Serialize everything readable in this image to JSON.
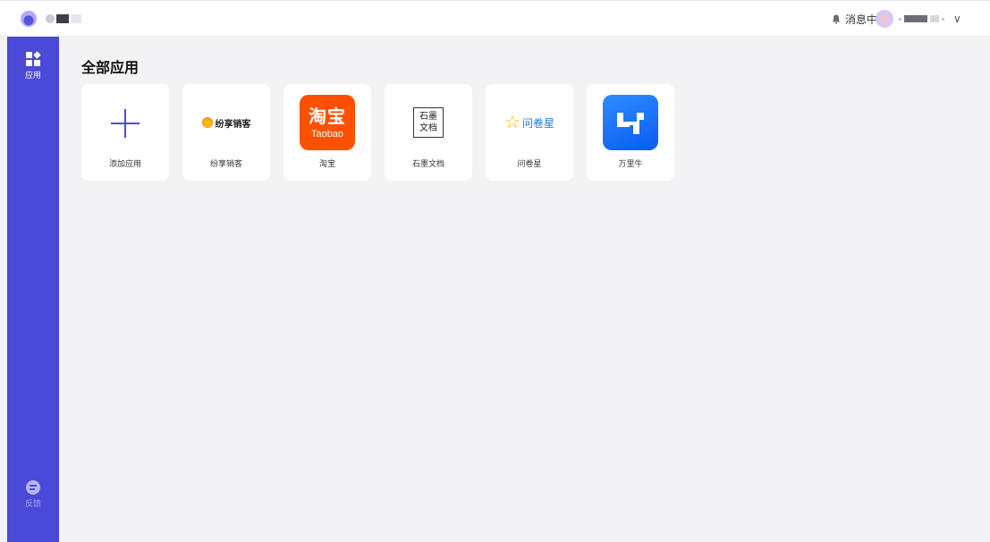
{
  "header": {
    "notifications_label": "消息中心",
    "user_menu_caret": "∨"
  },
  "sidebar": {
    "items": [
      {
        "label": "应用",
        "icon": "apps-grid-icon"
      },
      {
        "label": "反馈",
        "icon": "feedback-icon"
      }
    ]
  },
  "main": {
    "title": "全部应用",
    "apps": [
      {
        "name": "添加应用",
        "icon": "plus-icon"
      },
      {
        "name": "纷享销客",
        "icon": "fenxiang-logo",
        "logo_text": "纷享销客"
      },
      {
        "name": "淘宝",
        "icon": "taobao-logo",
        "logo_text": "淘宝",
        "logo_subtext": "Taobao"
      },
      {
        "name": "石墨文档",
        "icon": "shimo-logo",
        "logo_text": "石墨文档"
      },
      {
        "name": "问卷星",
        "icon": "wenjuanxing-logo",
        "logo_text": "问卷星"
      },
      {
        "name": "万里牛",
        "icon": "wanliniu-logo"
      }
    ]
  },
  "colors": {
    "sidebar_bg": "#4b4ad8",
    "accent": "#4b4ad8",
    "page_bg": "#f3f3f5",
    "taobao": "#ff5000",
    "wanliniu": "#1a72f8"
  }
}
